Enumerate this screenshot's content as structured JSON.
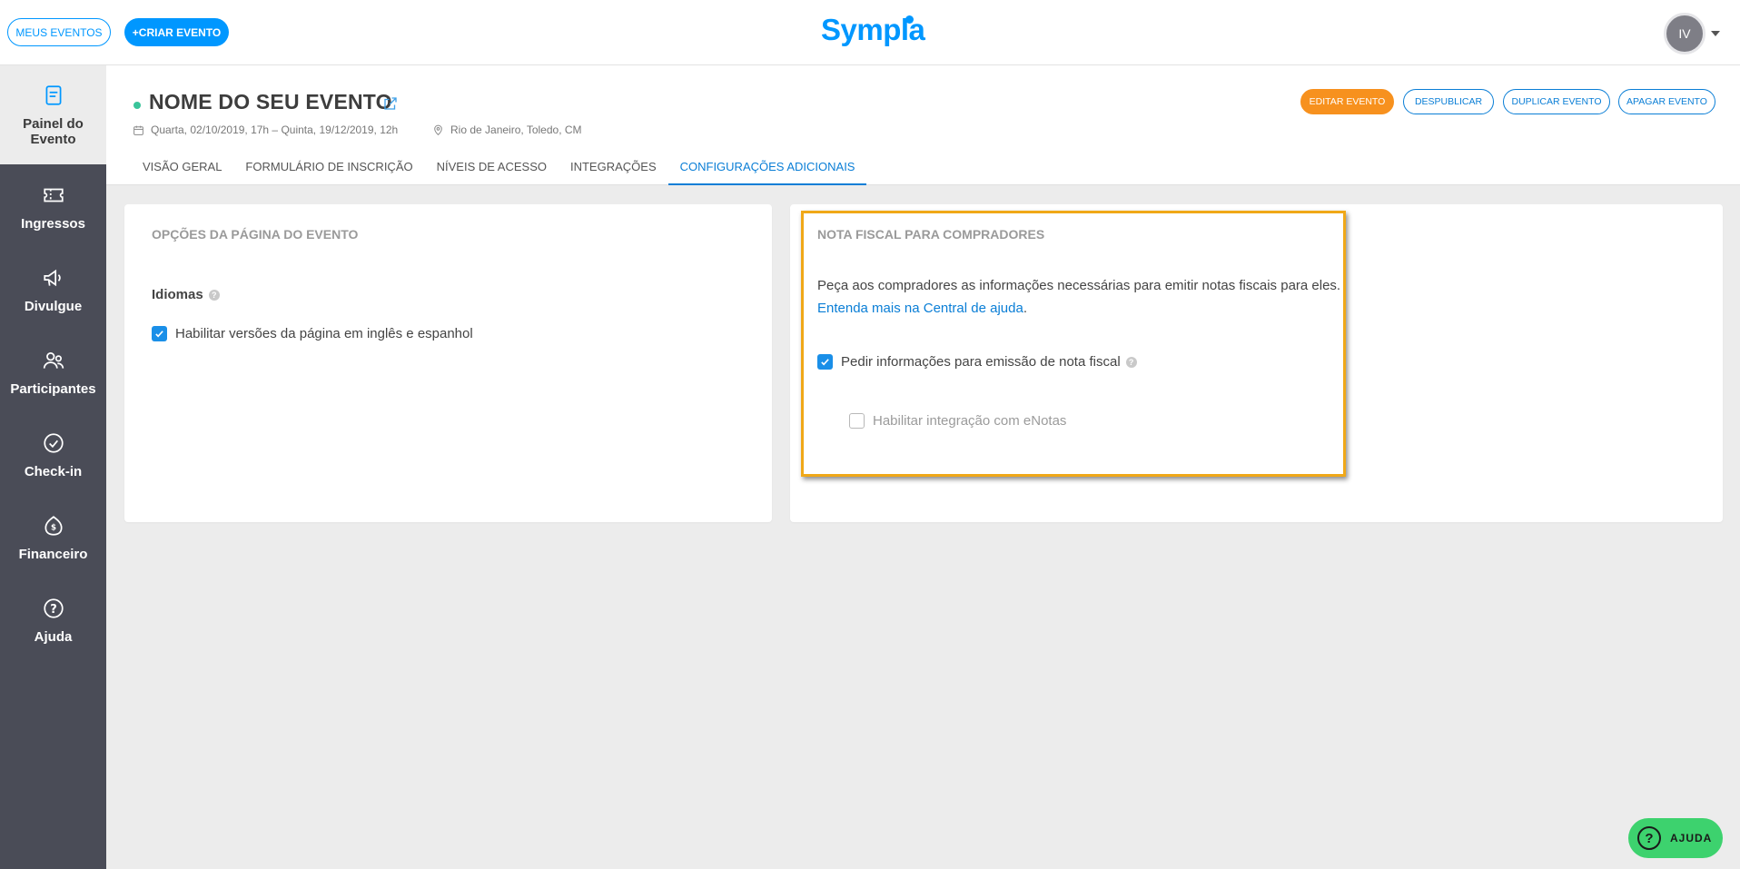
{
  "topbar": {
    "my_events": "MEUS EVENTOS",
    "create_event": "+CRIAR EVENTO",
    "logo": "Sympla",
    "avatar_initials": "IV"
  },
  "sidebar": {
    "items": [
      {
        "label": "Painel do Evento",
        "icon": "document-icon",
        "active": true
      },
      {
        "label": "Ingressos",
        "icon": "ticket-icon"
      },
      {
        "label": "Divulgue",
        "icon": "megaphone-icon"
      },
      {
        "label": "Participantes",
        "icon": "people-icon"
      },
      {
        "label": "Check-in",
        "icon": "check-circle-icon"
      },
      {
        "label": "Financeiro",
        "icon": "money-icon"
      },
      {
        "label": "Ajuda",
        "icon": "help-circle-icon"
      }
    ]
  },
  "event": {
    "title": "NOME DO SEU EVENTO",
    "dates": "Quarta, 02/10/2019, 17h – Quinta, 19/12/2019, 12h",
    "location": "Rio de Janeiro, Toledo, CM",
    "status_color": "#3ac49a"
  },
  "actions": {
    "edit": "EDITAR EVENTO",
    "unpublish": "DESPUBLICAR",
    "duplicate": "DUPLICAR EVENTO",
    "delete": "APAGAR EVENTO"
  },
  "tabs": [
    {
      "label": "VISÃO GERAL"
    },
    {
      "label": "FORMULÁRIO DE INSCRIÇÃO"
    },
    {
      "label": "NÍVEIS DE ACESSO"
    },
    {
      "label": "INTEGRAÇÕES"
    },
    {
      "label": "CONFIGURAÇÕES ADICIONAIS",
      "active": true
    }
  ],
  "page_options": {
    "title": "OPÇÕES DA PÁGINA DO EVENTO",
    "languages_label": "Idiomas",
    "enable_languages": "Habilitar versões da página em inglês e espanhol",
    "enable_languages_checked": true
  },
  "invoice": {
    "title": "NOTA FISCAL PARA COMPRADORES",
    "description": "Peça aos compradores as informações necessárias para emitir notas fiscais para eles.",
    "help_link": "Entenda mais na Central de ajuda",
    "help_link_suffix": ".",
    "request_info": "Pedir informações para emissão de nota fiscal",
    "request_info_checked": true,
    "enotas": "Habilitar integração com eNotas",
    "enotas_checked": false
  },
  "help_button": {
    "label": "AJUDA",
    "icon": "?"
  },
  "colors": {
    "brand": "#0097ff",
    "accent_orange": "#f7911e",
    "highlight": "#f0a818",
    "help_green": "#3dd26e"
  }
}
